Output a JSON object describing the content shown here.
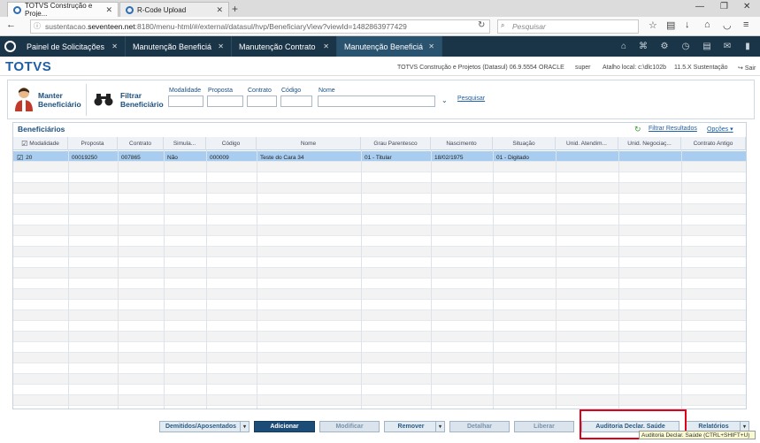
{
  "browser": {
    "tabs": [
      {
        "title": "TOTVS Construção e Proje...",
        "active": true
      },
      {
        "title": "R-Code Upload",
        "active": false
      }
    ],
    "url_prefix": "sustentacao.",
    "url_domain": "seventeen.net",
    "url_rest": ":8180/menu-html/#/external/datasul/hvp/BeneficiaryView?viewId=1482863977429",
    "search_placeholder": "Pesquisar"
  },
  "app_tabs": [
    {
      "label": "Painel de Solicitações",
      "active": false
    },
    {
      "label": "Manutenção Beneficiá",
      "active": false
    },
    {
      "label": "Manutenção Contrato",
      "active": false
    },
    {
      "label": "Manutenção Beneficiá",
      "active": true
    }
  ],
  "header": {
    "brand": "TOTVS",
    "company": "TOTVS Construção e Projetos (Datasul) 06.9.5554",
    "db": "ORACLE",
    "user": "super",
    "shortcut": "Atalho local: c:\\dlc102b",
    "version": "11.5.X Sustentação",
    "exit": "Sair"
  },
  "form": {
    "manter_label": "Manter Beneficiário",
    "filtrar_label": "Filtrar Beneficiário",
    "fields": {
      "modalidade": "Modalidade",
      "proposta": "Proposta",
      "contrato": "Contrato",
      "codigo": "Código",
      "nome": "Nome"
    },
    "search_link": "Pesquisar"
  },
  "grid": {
    "title": "Beneficiários",
    "filter_link": "Filtrar Resultados",
    "options_link": "Opções",
    "columns": [
      "Modalidade",
      "Proposta",
      "Contrato",
      "Simula...",
      "Código",
      "Nome",
      "Grau Parentesco",
      "Nascimento",
      "Situação",
      "Unid. Atendim...",
      "Unid. Negociaç...",
      "Contrato Antigo"
    ],
    "rows": [
      [
        "20",
        "00019250",
        "007865",
        "Não",
        "000009",
        "Teste do Cara 34",
        "01 - Titular",
        "18/02/1975",
        "01 - Digitado",
        "",
        "",
        ""
      ]
    ]
  },
  "buttons": {
    "demitidos": "Demitidos/Aposentados",
    "adicionar": "Adicionar",
    "modificar": "Modificar",
    "remover": "Remover",
    "detalhar": "Detalhar",
    "liberar": "Liberar",
    "auditoria": "Auditoria Declar. Saúde",
    "relatorios": "Relatórios"
  },
  "tooltip": "Auditoria Declar. Saúde (CTRL+SHIFT+U)"
}
